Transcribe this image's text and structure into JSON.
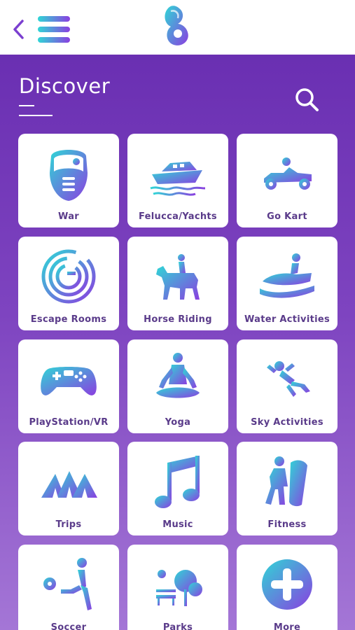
{
  "header": {
    "title": "Discover"
  },
  "colors": {
    "accent_start": "#2fd6d6",
    "accent_end": "#8a3fe0",
    "background_top": "#6a2fb2",
    "background_bottom": "#a476d6"
  },
  "categories": [
    {
      "label": "War",
      "icon": "paintball-mask-icon"
    },
    {
      "label": "Felucca/Yachts",
      "icon": "yacht-icon"
    },
    {
      "label": "Go Kart",
      "icon": "go-kart-icon"
    },
    {
      "label": "Escape Rooms",
      "icon": "maze-icon"
    },
    {
      "label": "Horse Riding",
      "icon": "horse-rider-icon"
    },
    {
      "label": "Water Activities",
      "icon": "jet-ski-icon"
    },
    {
      "label": "PlayStation/VR",
      "icon": "gamepad-icon"
    },
    {
      "label": "Yoga",
      "icon": "yoga-icon"
    },
    {
      "label": "Sky Activities",
      "icon": "skydiver-icon"
    },
    {
      "label": "Trips",
      "icon": "tents-icon"
    },
    {
      "label": "Music",
      "icon": "music-note-icon"
    },
    {
      "label": "Fitness",
      "icon": "fitness-icon"
    },
    {
      "label": "Soccer",
      "icon": "soccer-player-icon"
    },
    {
      "label": "Parks",
      "icon": "park-icon"
    },
    {
      "label": "More",
      "icon": "plus-icon"
    }
  ]
}
